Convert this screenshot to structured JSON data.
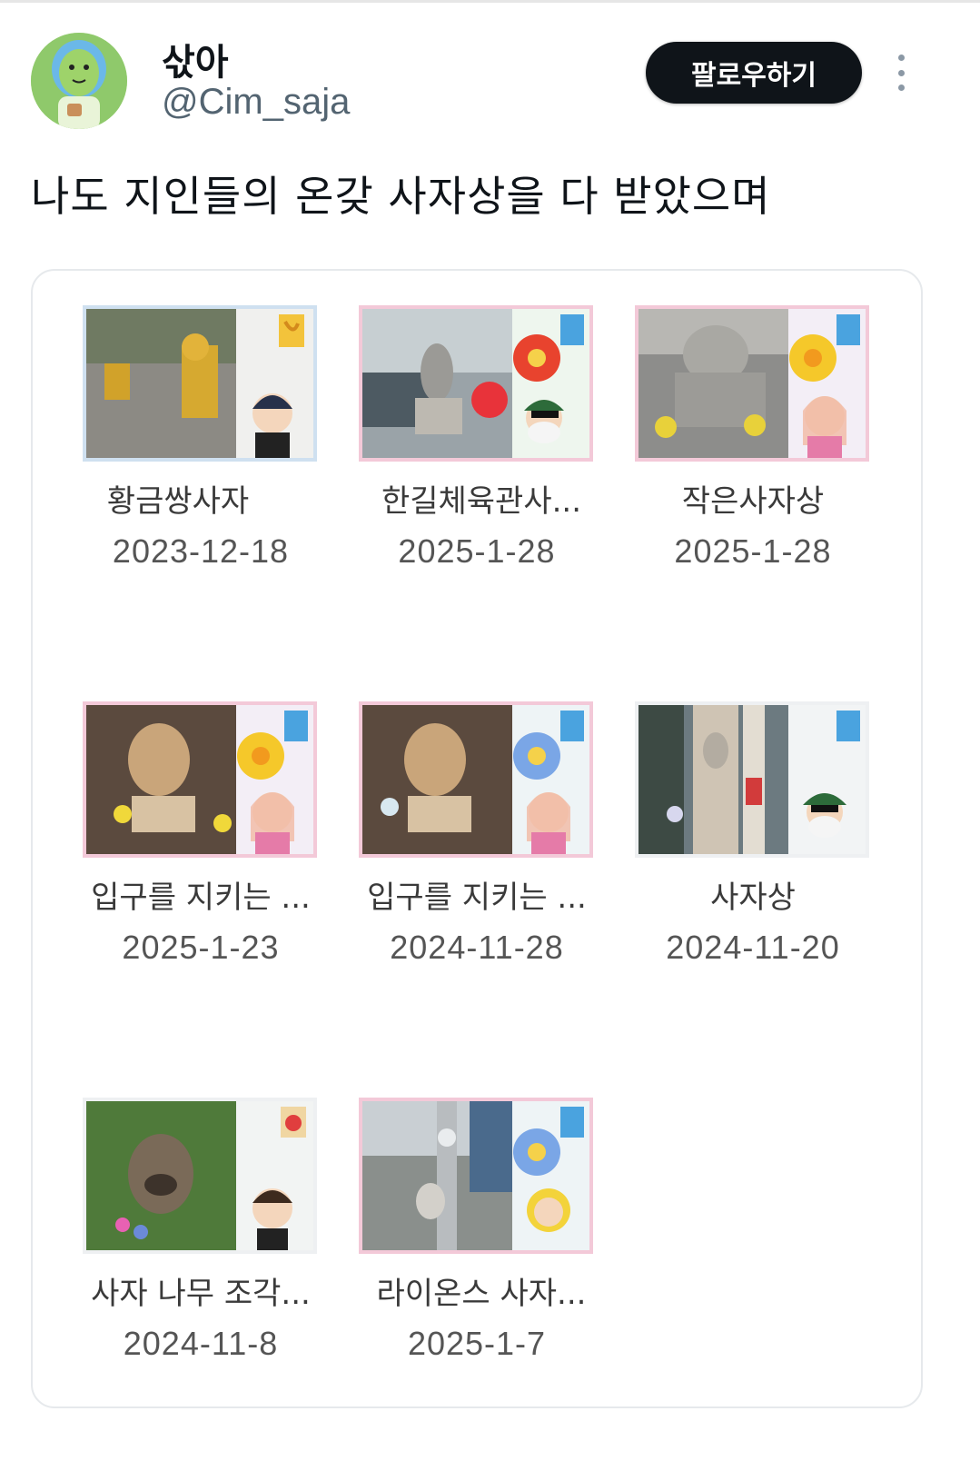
{
  "user": {
    "display_name": "삯아",
    "handle": "@Cim_saja",
    "follow_label": "팔로우하기"
  },
  "tweet": {
    "text": "나도 지인들의 온갖 사자상을 다 받았으며"
  },
  "postcards": [
    {
      "title": "황금쌍사자",
      "date": "2023-12-18",
      "stamp": "banana",
      "flower": "none",
      "photo": "gold-lion-stairs"
    },
    {
      "title": "한길체육관사...",
      "date": "2025-1-28",
      "stamp": "cherry",
      "flower": "red",
      "photo": "stone-lion-building"
    },
    {
      "title": "작은사자상",
      "date": "2025-1-28",
      "stamp": "cherry",
      "flower": "yellow",
      "photo": "stone-lion-gray"
    },
    {
      "title": "입구를 지키는 ...",
      "date": "2025-1-23",
      "stamp": "cherry",
      "flower": "yellow",
      "photo": "tan-lion-entrance"
    },
    {
      "title": "입구를 지키는 ...",
      "date": "2024-11-28",
      "stamp": "cherry",
      "flower": "blue",
      "photo": "tan-lion-entrance"
    },
    {
      "title": "사자상",
      "date": "2024-11-20",
      "stamp": "cherry",
      "flower": "none",
      "photo": "lion-pillar"
    },
    {
      "title": "사자 나무 조각...",
      "date": "2024-11-8",
      "stamp": "strawberry",
      "flower": "none",
      "photo": "wood-lion-garden"
    },
    {
      "title": "라이온스 사자...",
      "date": "2025-1-7",
      "stamp": "cherry",
      "flower": "blue",
      "photo": "lions-monument"
    }
  ],
  "colors": {
    "follow_bg": "#0f1419",
    "handle": "#536471",
    "card_border": "#e6e9ec"
  },
  "icons": [
    "more-options-icon",
    "avatar-image"
  ]
}
